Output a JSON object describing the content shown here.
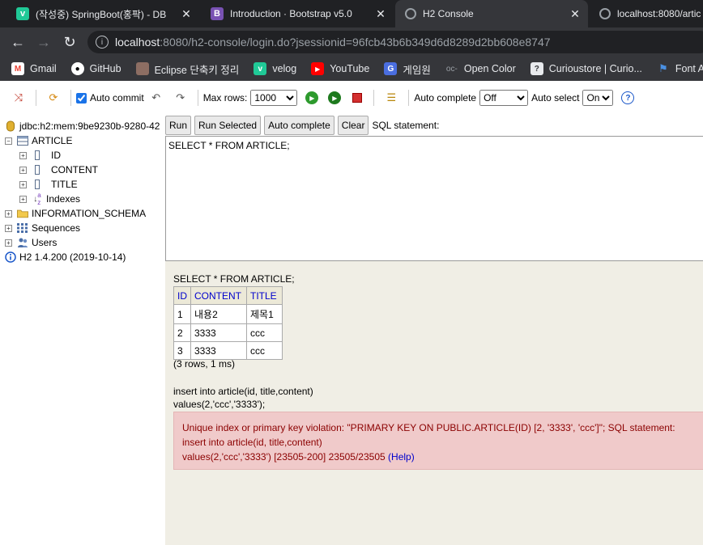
{
  "browser": {
    "tabs": [
      {
        "title": "(작성중) SpringBoot(홍팍) - DB",
        "favicon": "v",
        "active": false
      },
      {
        "title": "Introduction · Bootstrap v5.0",
        "favicon": "B",
        "active": false
      },
      {
        "title": "H2 Console",
        "favicon": "globe",
        "active": true
      },
      {
        "title": "localhost:8080/artic",
        "favicon": "globe",
        "active": false
      }
    ],
    "url_host": "localhost",
    "url_path": ":8080/h2-console/login.do?jsessionid=96fcb43b6b349d6d8289d2bb608e8747",
    "bookmarks": [
      "Gmail",
      "GitHub",
      "Eclipse 단축키 정리",
      "velog",
      "YouTube",
      "게임원",
      "Open Color",
      "Curioustore | Curio...",
      "Font Aw"
    ]
  },
  "toolbar": {
    "auto_commit_label": "Auto commit",
    "max_rows_label": "Max rows:",
    "max_rows_value": "1000",
    "auto_complete_label": "Auto complete",
    "auto_complete_value": "Off",
    "auto_select_label": "Auto select",
    "auto_select_value": "On"
  },
  "tree": {
    "connection": "jdbc:h2:mem:9be9230b-9280-42",
    "table": "ARTICLE",
    "columns": [
      "ID",
      "CONTENT",
      "TITLE"
    ],
    "indexes": "Indexes",
    "schema": "INFORMATION_SCHEMA",
    "sequences": "Sequences",
    "users": "Users",
    "version": "H2 1.4.200 (2019-10-14)"
  },
  "query_buttons": {
    "run": "Run",
    "run_selected": "Run Selected",
    "auto_complete": "Auto complete",
    "clear": "Clear",
    "sql_label": "SQL statement:"
  },
  "sql_input": "SELECT * FROM ARTICLE;",
  "result": {
    "query": "SELECT * FROM ARTICLE;",
    "headers": [
      "ID",
      "CONTENT",
      "TITLE"
    ],
    "rows": [
      [
        "1",
        "내용2",
        "제목1"
      ],
      [
        "2",
        "3333",
        "ccc"
      ],
      [
        "3",
        "3333",
        "ccc"
      ]
    ],
    "count": "(3 rows, 1 ms)",
    "insert_line1": "insert into article(id, title,content)",
    "insert_line2": "values(2,'ccc','3333');",
    "error_line1": "Unique index or primary key violation: \"PRIMARY KEY ON PUBLIC.ARTICLE(ID) [2, '3333', 'ccc']\"; SQL statement:",
    "error_line2": "insert into article(id, title,content)",
    "error_line3": "values(2,'ccc','3333') [23505-200] 23505/23505",
    "error_help": "(Help)"
  }
}
